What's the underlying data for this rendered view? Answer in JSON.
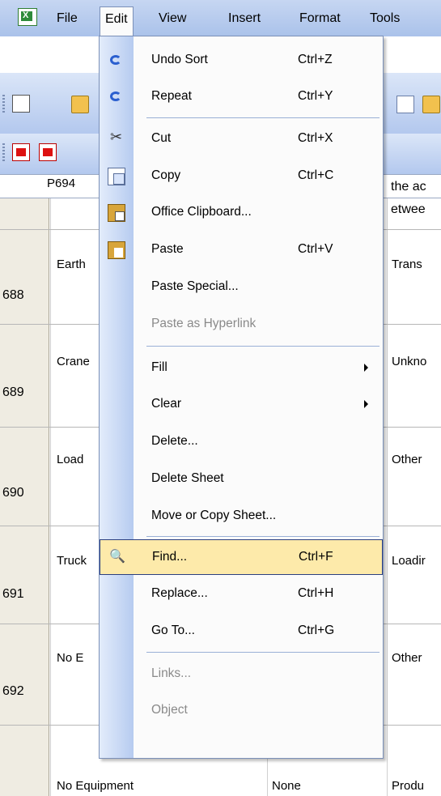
{
  "menubar": {
    "items": [
      {
        "label": "File"
      },
      {
        "label": "Edit"
      },
      {
        "label": "View"
      },
      {
        "label": "Insert"
      },
      {
        "label": "Format"
      },
      {
        "label": "Tools"
      }
    ]
  },
  "namebox": {
    "value": "P694"
  },
  "formula": {
    "line1": "the ac",
    "line2": "etwee"
  },
  "grid": {
    "rows": [
      {
        "num": "688",
        "col_b": "Earth",
        "col_d": "Trans"
      },
      {
        "num": "689",
        "col_b": "Crane",
        "col_d": "Unkno"
      },
      {
        "num": "690",
        "col_b": "Load",
        "col_d": "Other"
      },
      {
        "num": "691",
        "col_b": "Truck",
        "col_d": "Loadir"
      },
      {
        "num": "692",
        "col_b": "No E",
        "col_d": "Other"
      }
    ],
    "last_row": {
      "col_b": "No Equipment",
      "col_c": "None",
      "col_d": "Produ"
    }
  },
  "edit_menu": {
    "items": [
      {
        "label": "Undo Sort",
        "shortcut": "Ctrl+Z",
        "icon": "undo-icon"
      },
      {
        "label": "Repeat",
        "shortcut": "Ctrl+Y",
        "icon": "repeat-icon"
      },
      {
        "label": "Cut",
        "shortcut": "Ctrl+X",
        "icon": "cut-icon"
      },
      {
        "label": "Copy",
        "shortcut": "Ctrl+C",
        "icon": "copy-icon"
      },
      {
        "label": "Office Clipboard...",
        "shortcut": "",
        "icon": "clipboard-icon"
      },
      {
        "label": "Paste",
        "shortcut": "Ctrl+V",
        "icon": "paste-icon"
      },
      {
        "label": "Paste Special...",
        "shortcut": ""
      },
      {
        "label": "Paste as Hyperlink",
        "shortcut": "",
        "disabled": true
      },
      {
        "label": "Fill",
        "shortcut": "",
        "submenu": true
      },
      {
        "label": "Clear",
        "shortcut": "",
        "submenu": true
      },
      {
        "label": "Delete...",
        "shortcut": ""
      },
      {
        "label": "Delete Sheet",
        "shortcut": ""
      },
      {
        "label": "Move or Copy Sheet...",
        "shortcut": ""
      },
      {
        "label": "Find...",
        "shortcut": "Ctrl+F",
        "icon": "find-icon",
        "highlighted": true
      },
      {
        "label": "Replace...",
        "shortcut": "Ctrl+H"
      },
      {
        "label": "Go To...",
        "shortcut": "Ctrl+G"
      },
      {
        "label": "Links...",
        "shortcut": "",
        "disabled": true
      },
      {
        "label": "Object",
        "shortcut": "",
        "disabled": true
      }
    ]
  },
  "colors": {
    "highlight": "#fdeaaa",
    "menubar": "#b8cdef",
    "gutter": "#c4d6f3"
  }
}
